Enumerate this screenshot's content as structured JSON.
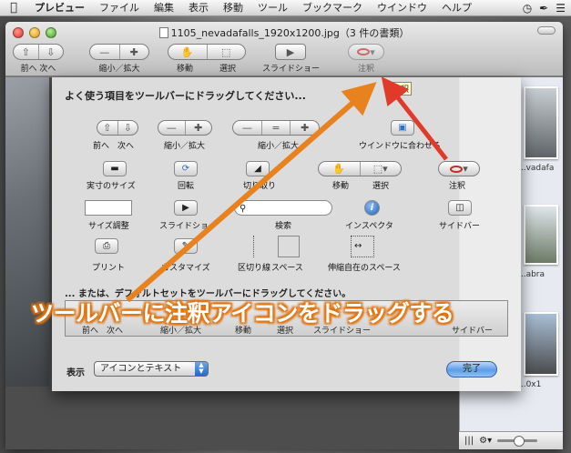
{
  "menubar": {
    "apple": "",
    "app_name": "プレビュー",
    "items": [
      "ファイル",
      "編集",
      "表示",
      "移動",
      "ツール",
      "ブックマーク",
      "ウインドウ",
      "ヘルプ"
    ]
  },
  "window": {
    "title": "1105_nevadafalls_1920x1200.jpg（3 件の書類）",
    "toolbar": {
      "back_forward_label": "前へ 次へ",
      "zoom_label": "縮小／拡大",
      "move_label": "移動",
      "select_label": "選択",
      "slideshow_label": "スライドショー",
      "annotate_label": "注釈"
    },
    "tooltip": "注釈"
  },
  "sheet": {
    "title": "よく使う項目をツールバーにドラッグしてください...",
    "items": {
      "back_forward": "前へ　次へ",
      "zoom": "縮小／拡大",
      "zoom_to_fit": "縮小／拡大",
      "fit_window": "ウインドウに合わせる",
      "actual_size": "実寸のサイズ",
      "rotate": "回転",
      "crop": "切り取り",
      "move": "移動",
      "select": "選択",
      "annotate": "注釈",
      "size_adjust": "サイズ調整",
      "slideshow": "スライドショー",
      "search": "検索",
      "inspector": "インスペクタ",
      "sidebar": "サイドバー",
      "print": "プリント",
      "customize": "カスタマイズ",
      "separator": "区切り線",
      "space": "スペース",
      "flexible_space": "伸縮自在のスペース"
    },
    "default_set_label": "... または、デフォルトセットをツールバーにドラッグしてください。",
    "default_bar": {
      "back_forward": "前へ　次へ",
      "zoom": "縮小／拡大",
      "move": "移動",
      "select": "選択",
      "slideshow": "スライドショー",
      "sidebar": "サイドバー"
    },
    "show_label": "表示",
    "show_value": "アイコンとテキスト",
    "done_label": "完了"
  },
  "sidebar": {
    "captions": [
      "...vadafa",
      "...abra",
      "...0x1"
    ]
  },
  "overlay": {
    "caption": "ツールバーに注釈アイコンをドラッグする"
  },
  "colors": {
    "arrow_orange": "#e8821e",
    "arrow_red": "#e03a2a",
    "caption_glow": "#e07410",
    "done_blue": "#5d9de8"
  }
}
